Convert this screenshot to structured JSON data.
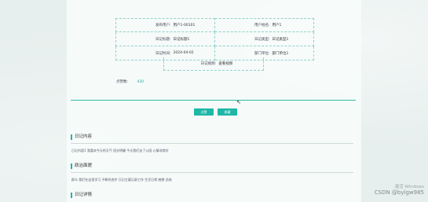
{
  "info": {
    "rows": [
      [
        {
          "label": "发布用户:",
          "value": "用户1-00101"
        },
        {
          "label": "用户姓名:",
          "value": "用户1"
        }
      ],
      [
        {
          "label": "日记标题:",
          "value": "日记标题1"
        },
        {
          "label": "日记类型:",
          "value": "日记类型1"
        }
      ],
      [
        {
          "label": "日记时间:",
          "value": "2024-04-02"
        },
        {
          "label": "部门单位:",
          "value": "部门单位1"
        }
      ]
    ],
    "last": {
      "label": "日记视频:",
      "value": "查看视频"
    }
  },
  "favorites": {
    "label": "点赞数:",
    "value": "430"
  },
  "buttons": {
    "favorite": "点赞",
    "back": "收藏"
  },
  "sections": [
    {
      "title": "日记内容",
      "text": "日记内容1 我喜欢今天的天气 阳光明媚 今天我们去了公园 心情非常好"
    },
    {
      "title": "政治面貌",
      "text": "群众 我们在这里学习 不断的进步 日记主要记录工作 生活日常 感想 总结"
    },
    {
      "title": "日记详情",
      "text": ""
    }
  ],
  "watermark": {
    "line1": "激活 Windows",
    "line2": "CSDN @bylgw985"
  }
}
